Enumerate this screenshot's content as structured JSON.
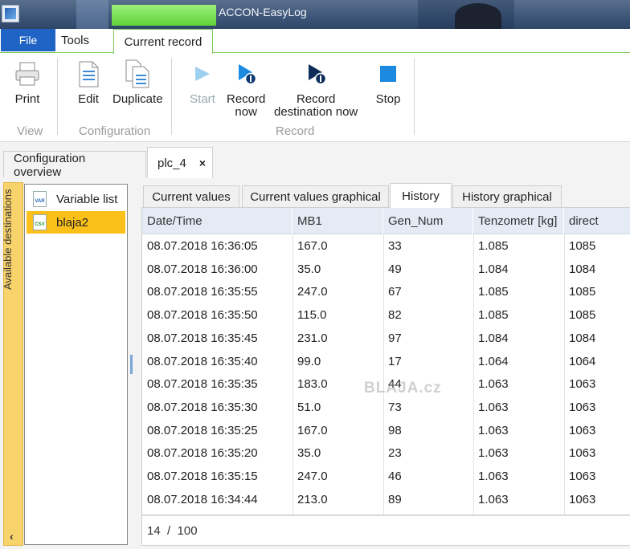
{
  "window": {
    "title": "ACCON-EasyLog"
  },
  "ribbon_tabs": {
    "file": "File",
    "tools": "Tools",
    "current_record": "Current record"
  },
  "ribbon": {
    "print": "Print",
    "edit": "Edit",
    "duplicate": "Duplicate",
    "start": "Start",
    "record_now": "Record now",
    "record_now_line1": "Record",
    "record_now_line2": "now",
    "record_dest_line1": "Record",
    "record_dest_line2": "destination now",
    "stop": "Stop",
    "group_view": "View",
    "group_configuration": "Configuration",
    "group_record": "Record"
  },
  "doc_tabs": {
    "overview": "Configuration overview",
    "plc": "plc_4",
    "close_glyph": "×"
  },
  "left_panel": {
    "available_destinations": "Available destinations",
    "collapse_glyph": "‹",
    "items": [
      {
        "label": "Variable list",
        "icon": "var-file-icon",
        "icon_text": "VAR"
      },
      {
        "label": "blaja2",
        "icon": "csv-file-icon",
        "icon_text": "CSV"
      }
    ]
  },
  "inner_tabs": {
    "current_values": "Current values",
    "current_values_graphical": "Current values graphical",
    "history": "History",
    "history_graphical": "History graphical"
  },
  "table": {
    "headers": [
      "Date/Time",
      "MB1",
      "Gen_Num",
      "Tenzometr [kg]",
      "direct"
    ],
    "rows": [
      [
        "08.07.2018 16:36:05",
        "167.0",
        "33",
        "1.085",
        "1085"
      ],
      [
        "08.07.2018 16:36:00",
        "35.0",
        "49",
        "1.084",
        "1084"
      ],
      [
        "08.07.2018 16:35:55",
        "247.0",
        "67",
        "1.085",
        "1085"
      ],
      [
        "08.07.2018 16:35:50",
        "115.0",
        "82",
        "1.085",
        "1085"
      ],
      [
        "08.07.2018 16:35:45",
        "231.0",
        "97",
        "1.084",
        "1084"
      ],
      [
        "08.07.2018 16:35:40",
        "99.0",
        "17",
        "1.064",
        "1064"
      ],
      [
        "08.07.2018 16:35:35",
        "183.0",
        "44",
        "1.063",
        "1063"
      ],
      [
        "08.07.2018 16:35:30",
        "51.0",
        "73",
        "1.063",
        "1063"
      ],
      [
        "08.07.2018 16:35:25",
        "167.0",
        "98",
        "1.063",
        "1063"
      ],
      [
        "08.07.2018 16:35:20",
        "35.0",
        "23",
        "1.063",
        "1063"
      ],
      [
        "08.07.2018 16:35:15",
        "247.0",
        "46",
        "1.063",
        "1063"
      ],
      [
        "08.07.2018 16:34:44",
        "213.0",
        "89",
        "1.063",
        "1063"
      ]
    ]
  },
  "pager": {
    "text": "14  /  100"
  },
  "watermark": "BLAJA.cz",
  "colors": {
    "accent_green": "#7cc95a",
    "file_blue": "#1f64c4",
    "selection": "#fbc11a",
    "grid_header": "#e4ebf5"
  }
}
